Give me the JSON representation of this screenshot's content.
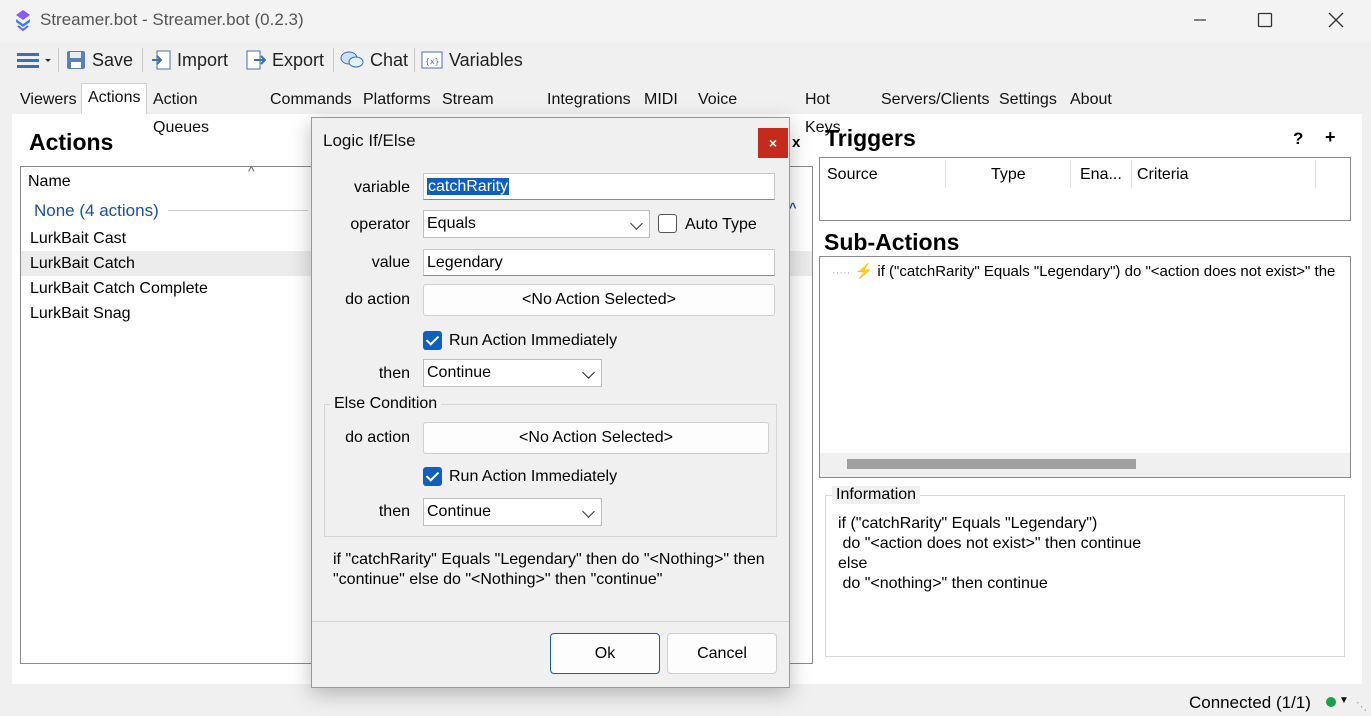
{
  "window": {
    "title": "Streamer.bot - Streamer.bot (0.2.3)",
    "icons": {
      "logo": "streamerbot-logo-icon",
      "minimize": "minimize-icon",
      "maximize": "maximize-icon",
      "close": "close-icon"
    }
  },
  "toolbar": {
    "save_label": "Save",
    "import_label": "Import",
    "export_label": "Export",
    "chat_label": "Chat",
    "variables_label": "Variables"
  },
  "tabs": [
    {
      "label": "Viewers"
    },
    {
      "label": "Actions"
    },
    {
      "label": "Action Queues"
    },
    {
      "label": "Commands"
    },
    {
      "label": "Platforms"
    },
    {
      "label": "Stream Apps"
    },
    {
      "label": "Integrations"
    },
    {
      "label": "MIDI"
    },
    {
      "label": "Voice Control"
    },
    {
      "label": "Hot Keys"
    },
    {
      "label": "Servers/Clients"
    },
    {
      "label": "Settings"
    },
    {
      "label": "About"
    }
  ],
  "active_tab": "Actions",
  "actions": {
    "title": "Actions",
    "column_name": "Name",
    "group_label": "None (4 actions)",
    "items": [
      "LurkBait Cast",
      "LurkBait Catch",
      "LurkBait Catch Complete",
      "LurkBait Snag"
    ],
    "selected": "LurkBait Catch",
    "close_label": "x"
  },
  "triggers": {
    "title": "Triggers",
    "help_label": "?",
    "add_label": "+",
    "columns": [
      "Source",
      "Type",
      "Ena...",
      "Criteria"
    ]
  },
  "sub_actions": {
    "title": "Sub-Actions",
    "line": "if (\"catchRarity\" Equals \"Legendary\") do \"<action does not exist>\" the"
  },
  "information": {
    "title": "Information",
    "text": "if (\"catchRarity\" Equals \"Legendary\")\n do \"<action does not exist>\" then continue\nelse\n do \"<nothing>\" then continue"
  },
  "status": {
    "connected": "Connected (1/1)",
    "dot_color": "#16a34a"
  },
  "dialog": {
    "title": "Logic If/Else",
    "close_label": "×",
    "variable_label": "variable",
    "variable_value": "catchRarity",
    "operator_label": "operator",
    "operator_value": "Equals",
    "auto_type_label": "Auto Type",
    "auto_type_checked": false,
    "value_label": "value",
    "value_value": "Legendary",
    "do_action_label": "do action",
    "do_action_button": "<No Action Selected>",
    "run_immediately_label": "Run Action Immediately",
    "run_immediately_checked": true,
    "then_label": "then",
    "then_value": "Continue",
    "else_group_title": "Else Condition",
    "else_do_action_label": "do action",
    "else_do_action_button": "<No Action Selected>",
    "else_run_immediately_label": "Run Action Immediately",
    "else_run_immediately_checked": true,
    "else_then_label": "then",
    "else_then_value": "Continue",
    "summary": "if \"catchRarity\" Equals \"Legendary\" then do \"<Nothing>\" then \"continue\" else do \"<Nothing>\" then \"continue\"",
    "ok_label": "Ok",
    "cancel_label": "Cancel"
  },
  "colors": {
    "accent": "#0f5fbf",
    "close_red": "#c42b1c",
    "group_blue": "#1a4fa8"
  }
}
